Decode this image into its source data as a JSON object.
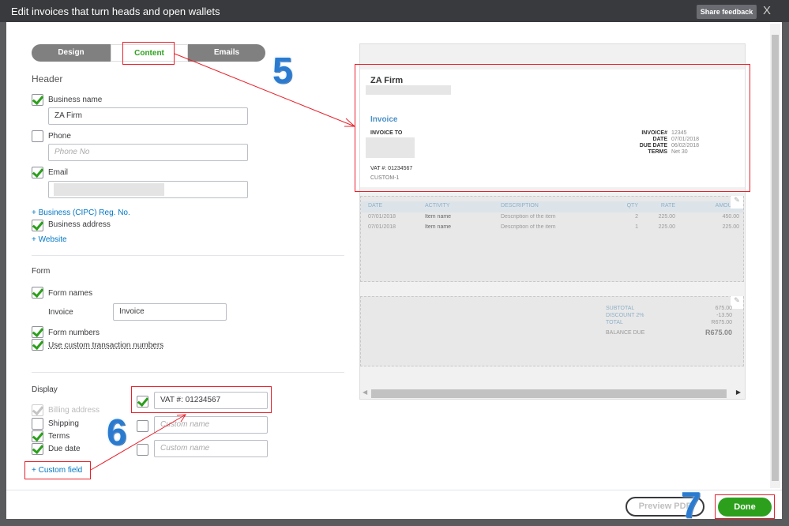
{
  "window": {
    "title": "Edit invoices that turn heads and open wallets",
    "share_feedback": "Share feedback",
    "close": "X"
  },
  "tabs": [
    {
      "label": "Design"
    },
    {
      "label": "Content",
      "active": true
    },
    {
      "label": "Emails"
    }
  ],
  "header": {
    "title": "Header",
    "business_name": {
      "label": "Business name",
      "checked": true,
      "value": "ZA Firm"
    },
    "phone": {
      "label": "Phone",
      "checked": false,
      "placeholder": "Phone No"
    },
    "email": {
      "label": "Email",
      "checked": true
    },
    "reg_link": "+ Business (CIPC) Reg. No.",
    "business_address": {
      "label": "Business address",
      "checked": true
    },
    "website_link": "+ Website"
  },
  "form": {
    "title": "Form",
    "form_names": {
      "label": "Form names",
      "checked": true
    },
    "invoice_label": "Invoice",
    "invoice_value": "Invoice",
    "form_numbers": {
      "label": "Form numbers",
      "checked": true
    },
    "custom_numbers": {
      "label": "Use custom transaction numbers",
      "checked": true
    }
  },
  "display": {
    "title": "Display",
    "billing": {
      "label": "Billing address",
      "checked": true,
      "disabled": true
    },
    "shipping": {
      "label": "Shipping",
      "checked": false
    },
    "terms": {
      "label": "Terms",
      "checked": true
    },
    "due_date": {
      "label": "Due date",
      "checked": true
    },
    "custom_field_link": "+ Custom field",
    "custom_fields": [
      {
        "checked": true,
        "value": "VAT #: 01234567"
      },
      {
        "checked": false,
        "placeholder": "Custom name"
      },
      {
        "checked": false,
        "placeholder": "Custom name"
      }
    ]
  },
  "preview": {
    "company": "ZA Firm",
    "doc_title": "Invoice",
    "invoice_to": "INVOICE TO",
    "vat": "VAT #: 01234567",
    "custom1": "CUSTOM-1",
    "meta": [
      {
        "k": "INVOICE#",
        "v": "12345"
      },
      {
        "k": "DATE",
        "v": "07/01/2018"
      },
      {
        "k": "DUE DATE",
        "v": "06/02/2018"
      },
      {
        "k": "TERMS",
        "v": "Net 30"
      }
    ],
    "columns": [
      "DATE",
      "ACTIVITY",
      "DESCRIPTION",
      "QTY",
      "RATE",
      "AMOUNT"
    ],
    "rows": [
      [
        "07/01/2018",
        "Item name",
        "Description of the item",
        "2",
        "225.00",
        "450.00"
      ],
      [
        "07/01/2018",
        "Item name",
        "Description of the item",
        "1",
        "225.00",
        "225.00"
      ]
    ],
    "totals": [
      {
        "k": "SUBTOTAL",
        "v": "675.00"
      },
      {
        "k": "DISCOUNT 2%",
        "v": "-13.50"
      },
      {
        "k": "TOTAL",
        "v": "R675.00"
      }
    ],
    "balance_label": "BALANCE DUE",
    "balance_value": "R675.00"
  },
  "footer": {
    "preview_pdf": "Preview PDF",
    "done": "Done"
  },
  "annotations": [
    "5",
    "6",
    "7"
  ],
  "colors": {
    "accent": "#2ca01c",
    "link": "#0077c5",
    "annotation": "#e8212b"
  }
}
